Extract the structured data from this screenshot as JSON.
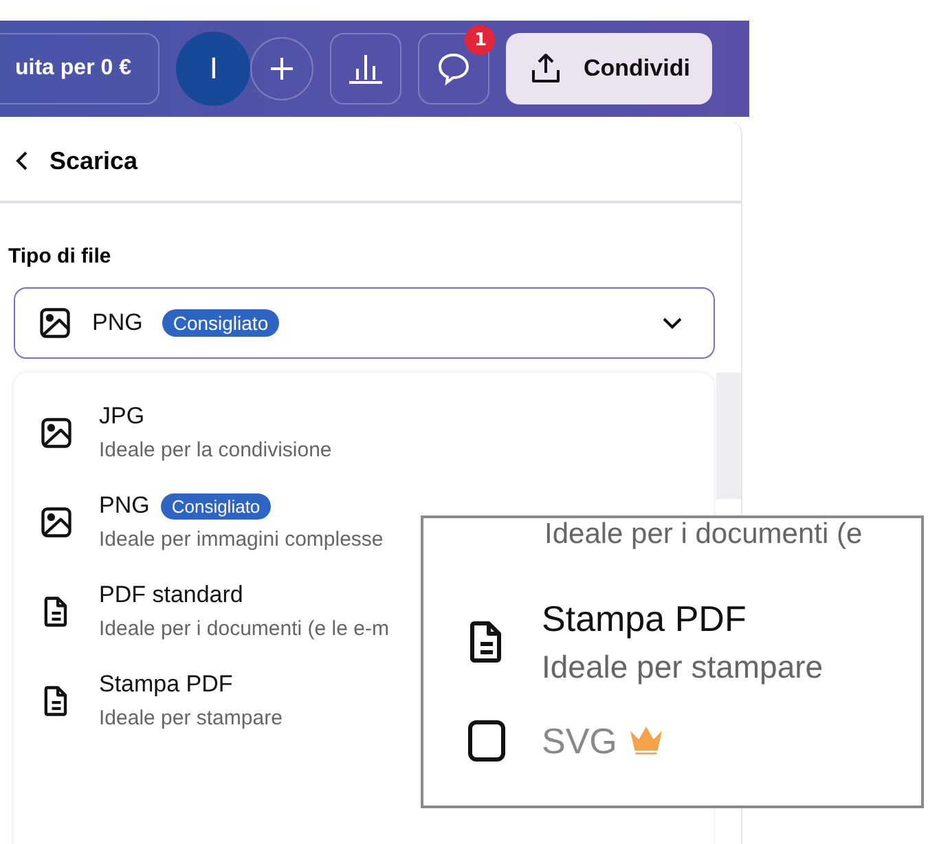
{
  "topbar": {
    "upgrade_button": "uita per 0 €",
    "avatar_initial": "I",
    "comments_badge": "1",
    "share_button": "Condividi"
  },
  "panel": {
    "title": "Scarica",
    "file_type_label": "Tipo di file",
    "select": {
      "value": "PNG",
      "badge": "Consigliato"
    },
    "options": [
      {
        "kind": "image",
        "title": "JPG",
        "description": "Ideale per la condivisione"
      },
      {
        "kind": "image",
        "title": "PNG",
        "badge": "Consigliato",
        "description": "Ideale per immagini complesse"
      },
      {
        "kind": "document",
        "title": "PDF standard",
        "description": "Ideale per i documenti (e le e-m"
      },
      {
        "kind": "document",
        "title": "Stampa PDF",
        "description": "Ideale per stampare"
      }
    ]
  },
  "zoom_inset": {
    "partial_description": "Ideale per i documenti (e",
    "options": [
      {
        "kind": "document",
        "title": "Stampa PDF",
        "description": "Ideale per stampare",
        "pro": false
      },
      {
        "kind": "vector",
        "title": "SVG",
        "pro": true
      }
    ]
  }
}
